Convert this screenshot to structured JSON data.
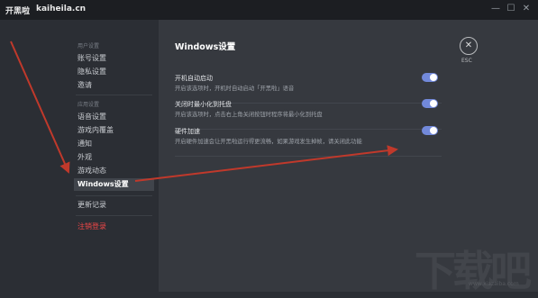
{
  "titlebar": {
    "brand": "开黑啦",
    "site": "kaiheila.cn",
    "minimize": "—",
    "maximize": "☐",
    "close": "✕"
  },
  "sidebar": {
    "user_group": "用户设置",
    "user_items": [
      "账号设置",
      "隐私设置",
      "邀请"
    ],
    "app_group": "应用设置",
    "app_items": [
      "语音设置",
      "游戏内覆盖",
      "通知",
      "外观",
      "游戏动态",
      "Windows设置"
    ],
    "active_index": 5,
    "changelog": "更新记录",
    "logout": "注销登录"
  },
  "main": {
    "title": "Windows设置",
    "esc_icon": "✕",
    "esc_label": "ESC",
    "rows": [
      {
        "title": "开机自动启动",
        "desc": "开启该选项时，开机时自动启动「开黑啦」语音",
        "on": true
      },
      {
        "title": "关闭时最小化到托盘",
        "desc": "开启该选项时，点击右上角关闭按钮时程序将最小化到托盘",
        "on": true
      },
      {
        "title": "硬件加速",
        "desc": "开启硬件加速会让开黑啦运行得更流畅，如果游戏发生掉帧，请关闭此功能",
        "on": true
      }
    ],
    "toggle_color": "#7289da"
  },
  "annotation_color": "#c0392b",
  "watermark": {
    "text": "下载吧",
    "url": "www.xiazaiba.com"
  }
}
